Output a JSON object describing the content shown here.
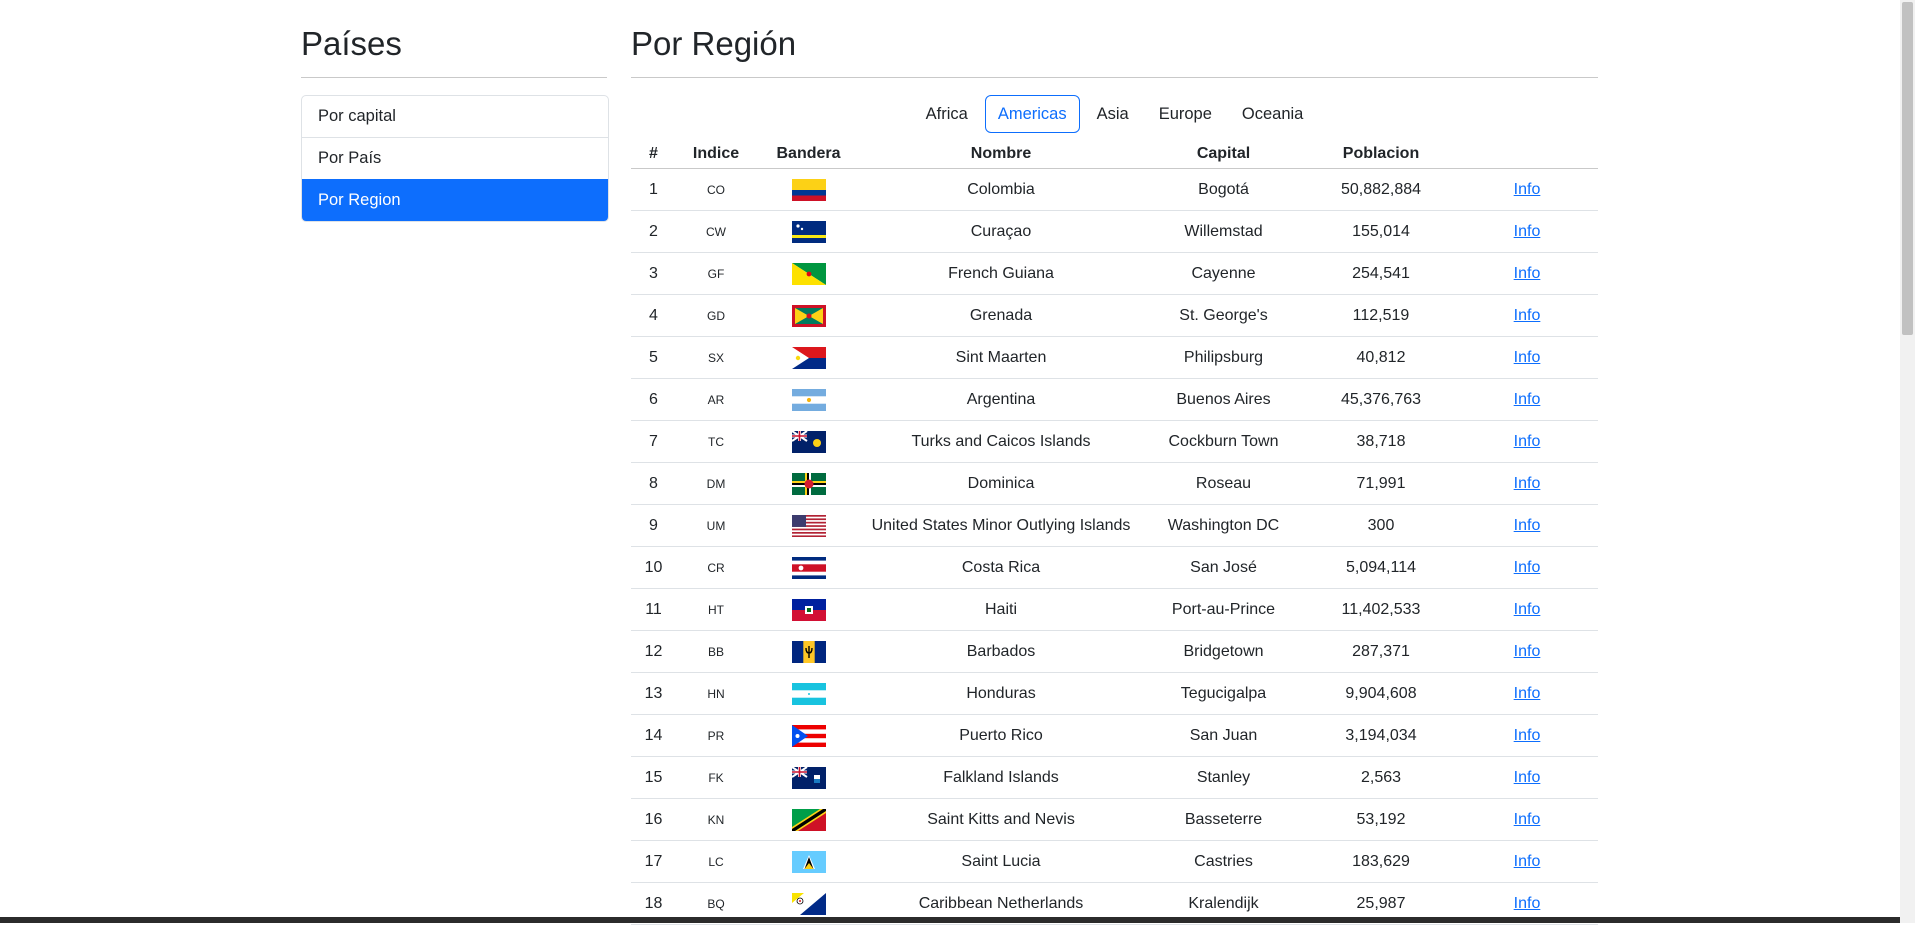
{
  "sidebar": {
    "title": "Países",
    "items": [
      {
        "label": "Por capital",
        "active": false
      },
      {
        "label": "Por País",
        "active": false
      },
      {
        "label": "Por Region",
        "active": true
      }
    ]
  },
  "main": {
    "title": "Por Región",
    "regions": [
      {
        "label": "Africa",
        "active": false
      },
      {
        "label": "Americas",
        "active": true
      },
      {
        "label": "Asia",
        "active": false
      },
      {
        "label": "Europe",
        "active": false
      },
      {
        "label": "Oceania",
        "active": false
      }
    ],
    "columns": [
      "#",
      "Indice",
      "Bandera",
      "Nombre",
      "Capital",
      "Poblacion",
      ""
    ],
    "rows": [
      {
        "num": "1",
        "code": "CO",
        "name": "Colombia",
        "capital": "Bogotá",
        "population": "50,882,884",
        "link": "Info",
        "flag": "co"
      },
      {
        "num": "2",
        "code": "CW",
        "name": "Curaçao",
        "capital": "Willemstad",
        "population": "155,014",
        "link": "Info",
        "flag": "cw"
      },
      {
        "num": "3",
        "code": "GF",
        "name": "French Guiana",
        "capital": "Cayenne",
        "population": "254,541",
        "link": "Info",
        "flag": "gf"
      },
      {
        "num": "4",
        "code": "GD",
        "name": "Grenada",
        "capital": "St. George's",
        "population": "112,519",
        "link": "Info",
        "flag": "gd"
      },
      {
        "num": "5",
        "code": "SX",
        "name": "Sint Maarten",
        "capital": "Philipsburg",
        "population": "40,812",
        "link": "Info",
        "flag": "sx"
      },
      {
        "num": "6",
        "code": "AR",
        "name": "Argentina",
        "capital": "Buenos Aires",
        "population": "45,376,763",
        "link": "Info",
        "flag": "ar"
      },
      {
        "num": "7",
        "code": "TC",
        "name": "Turks and Caicos Islands",
        "capital": "Cockburn Town",
        "population": "38,718",
        "link": "Info",
        "flag": "tc"
      },
      {
        "num": "8",
        "code": "DM",
        "name": "Dominica",
        "capital": "Roseau",
        "population": "71,991",
        "link": "Info",
        "flag": "dm"
      },
      {
        "num": "9",
        "code": "UM",
        "name": "United States Minor Outlying Islands",
        "capital": "Washington DC",
        "population": "300",
        "link": "Info",
        "flag": "um"
      },
      {
        "num": "10",
        "code": "CR",
        "name": "Costa Rica",
        "capital": "San José",
        "population": "5,094,114",
        "link": "Info",
        "flag": "cr"
      },
      {
        "num": "11",
        "code": "HT",
        "name": "Haiti",
        "capital": "Port-au-Prince",
        "population": "11,402,533",
        "link": "Info",
        "flag": "ht"
      },
      {
        "num": "12",
        "code": "BB",
        "name": "Barbados",
        "capital": "Bridgetown",
        "population": "287,371",
        "link": "Info",
        "flag": "bb"
      },
      {
        "num": "13",
        "code": "HN",
        "name": "Honduras",
        "capital": "Tegucigalpa",
        "population": "9,904,608",
        "link": "Info",
        "flag": "hn"
      },
      {
        "num": "14",
        "code": "PR",
        "name": "Puerto Rico",
        "capital": "San Juan",
        "population": "3,194,034",
        "link": "Info",
        "flag": "pr"
      },
      {
        "num": "15",
        "code": "FK",
        "name": "Falkland Islands",
        "capital": "Stanley",
        "population": "2,563",
        "link": "Info",
        "flag": "fk"
      },
      {
        "num": "16",
        "code": "KN",
        "name": "Saint Kitts and Nevis",
        "capital": "Basseterre",
        "population": "53,192",
        "link": "Info",
        "flag": "kn"
      },
      {
        "num": "17",
        "code": "LC",
        "name": "Saint Lucia",
        "capital": "Castries",
        "population": "183,629",
        "link": "Info",
        "flag": "lc"
      },
      {
        "num": "18",
        "code": "BQ",
        "name": "Caribbean Netherlands",
        "capital": "Kralendijk",
        "population": "25,987",
        "link": "Info",
        "flag": "bq"
      }
    ]
  },
  "colors": {
    "accent": "#0d6efd",
    "text": "#212529",
    "border": "#dee2e6"
  }
}
